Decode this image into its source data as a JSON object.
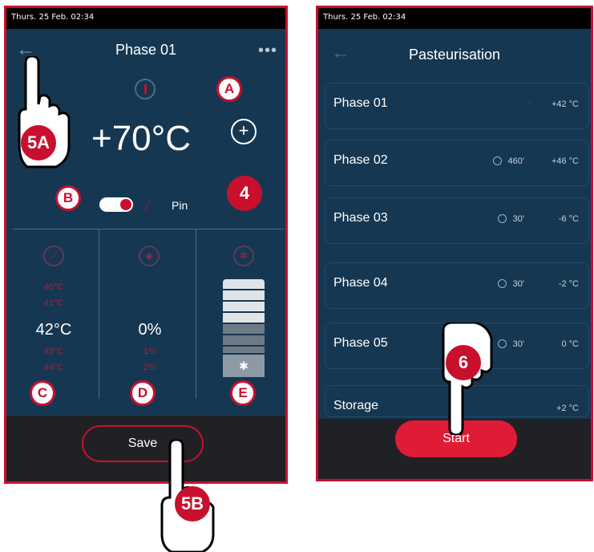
{
  "left": {
    "status": "Thurs. 25 Feb. 02:34",
    "title": "Phase 01",
    "temperature": "+70°C",
    "toggle_label": "Pin",
    "columns": [
      {
        "above1": "40°C",
        "above2": "41°C",
        "value": "42°C",
        "below1": "43°C",
        "below2": "44°C"
      },
      {
        "above1": "",
        "above2": "",
        "value": "0%",
        "below1": "1%",
        "below2": "2%"
      }
    ],
    "fan_level": 0.4,
    "save_label": "Save"
  },
  "right": {
    "status": "Thurs. 25 Feb. 02:34",
    "title": "Pasteurisation",
    "phases": [
      {
        "name": "Phase 01",
        "time": "",
        "temp": "+42 °C"
      },
      {
        "name": "Phase 02",
        "time": "460'",
        "temp": "+46 °C"
      },
      {
        "name": "Phase 03",
        "time": "30'",
        "temp": "-6 °C"
      },
      {
        "name": "Phase 04",
        "time": "30'",
        "temp": "-2 °C"
      },
      {
        "name": "Phase 05",
        "time": "30'",
        "temp": "0 °C"
      },
      {
        "name": "Storage",
        "time": "",
        "temp": "+2 °C"
      }
    ],
    "start_label": "Start"
  },
  "callouts": {
    "a": "A",
    "b": "B",
    "c": "C",
    "d": "D",
    "e": "E",
    "four": "4",
    "five_a": "5A",
    "five_b": "5B",
    "six": "6"
  },
  "colors": {
    "panel": "#163751",
    "accent": "#c8102e",
    "bar": "#202124"
  }
}
